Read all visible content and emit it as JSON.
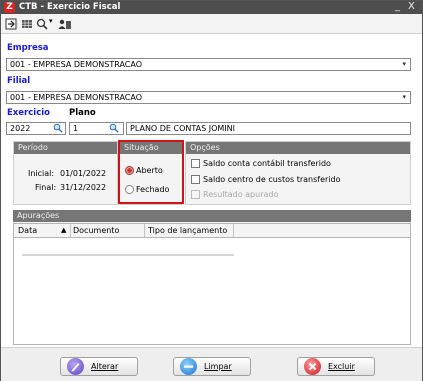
{
  "window": {
    "title": "CTB - Exercicio Fiscal",
    "logo_text": "Z",
    "minimize": "_",
    "close": "X"
  },
  "toolbar": {
    "icons": [
      "exit-icon",
      "grid-icon",
      "zoom-icon",
      "users-icon"
    ],
    "zoom_caret": "▾"
  },
  "empresa": {
    "label": "Empresa",
    "value": "001 - EMPRESA DEMONSTRACAO"
  },
  "filial": {
    "label": "Filial",
    "value": "001 - EMPRESA DEMONSTRACAO"
  },
  "exercicio": {
    "label": "Exercicio",
    "value": "2022"
  },
  "plano": {
    "label": "Plano",
    "code": "1",
    "name": "PLANO DE CONTAS JOMINI"
  },
  "periodo": {
    "title": "Período",
    "inicial_label": "Inicial:",
    "inicial_value": "01/01/2022",
    "final_label": "Final:",
    "final_value": "31/12/2022"
  },
  "situacao": {
    "title": "Situação",
    "options": [
      {
        "label": "Aberto",
        "checked": true
      },
      {
        "label": "Fechado",
        "checked": false
      }
    ]
  },
  "opcoes": {
    "title": "Opções",
    "items": [
      {
        "label": "Saldo conta contábil transferido",
        "enabled": true
      },
      {
        "label": "Saldo centro de custos transferido",
        "enabled": true
      },
      {
        "label": "Resultado apurado",
        "enabled": false
      }
    ]
  },
  "apuracoes": {
    "title": "Apurações",
    "columns": [
      "Data",
      "Documento",
      "Tipo de lançamento"
    ],
    "sort_indicator": "▲"
  },
  "footer": {
    "alterar": "Alterar",
    "limpar": "Limpar",
    "excluir": "Excluir"
  },
  "colors": {
    "accent_label": "#1a1ad0",
    "highlight": "#d0121b",
    "group_header": "#767676"
  }
}
